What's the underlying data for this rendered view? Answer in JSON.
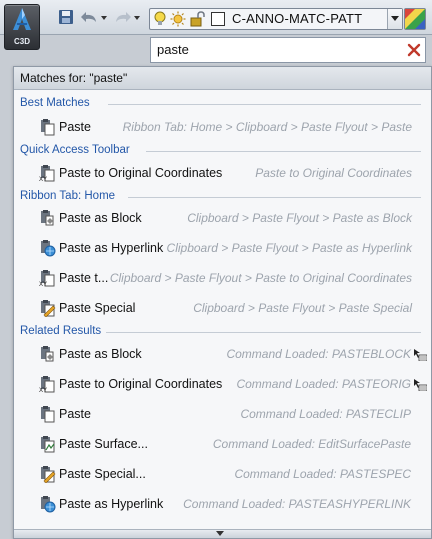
{
  "toolbar": {
    "app_label": "C3D",
    "layer_name": "C-ANNO-MATC-PATT"
  },
  "search": {
    "value": "paste"
  },
  "results": {
    "header": "Matches for: \"paste\"",
    "sections": {
      "best": "Best Matches",
      "qat": "Quick Access Toolbar",
      "ribbon": "Ribbon Tab: Home",
      "related": "Related Results"
    },
    "best": [
      {
        "label": "Paste",
        "path": "Ribbon Tab: Home > Clipboard > Paste Flyout > Paste",
        "icon": "paste-icon"
      }
    ],
    "qat": [
      {
        "label": "Paste to Original Coordinates",
        "path": "Paste to Original Coordinates",
        "icon": "paste-orig-icon"
      }
    ],
    "ribbon": [
      {
        "label": "Paste as Block",
        "path": "Clipboard > Paste Flyout > Paste as Block",
        "icon": "paste-block-icon"
      },
      {
        "label": "Paste as Hyperlink",
        "path": "Clipboard > Paste Flyout > Paste as Hyperlink",
        "icon": "paste-hyperlink-icon"
      },
      {
        "label": "Paste t...",
        "path": "Clipboard > Paste Flyout > Paste to Original Coordinates",
        "icon": "paste-orig-icon"
      },
      {
        "label": "Paste Special",
        "path": "Clipboard > Paste Flyout > Paste Special",
        "icon": "paste-special-icon"
      }
    ],
    "related": [
      {
        "label": "Paste as Block",
        "path": "Command Loaded: PASTEBLOCK",
        "icon": "paste-block-icon"
      },
      {
        "label": "Paste to Original Coordinates",
        "path": "Command Loaded: PASTEORIG",
        "icon": "paste-orig-icon"
      },
      {
        "label": "Paste",
        "path": "Command Loaded: PASTECLIP",
        "icon": "paste-icon"
      },
      {
        "label": "Paste Surface...",
        "path": "Command Loaded: EditSurfacePaste",
        "icon": "paste-surface-icon"
      },
      {
        "label": "Paste Special...",
        "path": "Command Loaded: PASTESPEC",
        "icon": "paste-special-icon"
      },
      {
        "label": "Paste as Hyperlink",
        "path": "Command Loaded: PASTEASHYPERLINK",
        "icon": "paste-hyperlink-icon"
      }
    ]
  }
}
